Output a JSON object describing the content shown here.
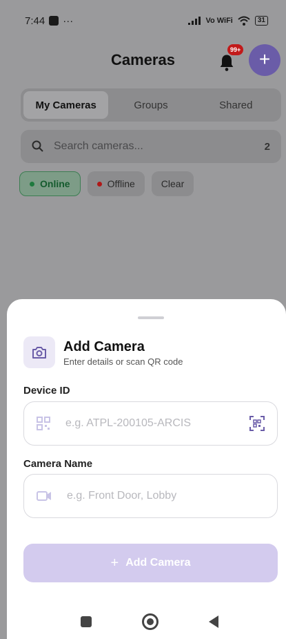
{
  "status": {
    "time": "7:44",
    "dots": "···",
    "network": "Vo WiFi",
    "battery": "31"
  },
  "header": {
    "title": "Cameras",
    "notification_badge": "99+",
    "add_icon": "+"
  },
  "tabs": [
    {
      "label": "My Cameras",
      "active": true
    },
    {
      "label": "Groups",
      "active": false
    },
    {
      "label": "Shared",
      "active": false
    }
  ],
  "search": {
    "placeholder": "Search cameras...",
    "count": "2"
  },
  "filters": {
    "online": "Online",
    "offline": "Offline",
    "clear": "Clear"
  },
  "sheet": {
    "title": "Add Camera",
    "subtitle": "Enter details or scan QR code",
    "device_id_label": "Device ID",
    "device_id_placeholder": "e.g. ATPL-200105-ARCIS",
    "camera_name_label": "Camera Name",
    "camera_name_placeholder": "e.g. Front Door, Lobby",
    "submit_plus": "+",
    "submit_label": "Add Camera"
  },
  "colors": {
    "accent": "#6a5ca8",
    "accent_light": "#d3cbee",
    "online_green": "#1f7a3e",
    "offline_red": "#c21a1a",
    "badge_red": "#c21a1a"
  },
  "icons": [
    "bell-icon",
    "plus-icon",
    "search-icon",
    "camera-icon",
    "qr-icon",
    "scan-qr-icon",
    "video-icon"
  ]
}
